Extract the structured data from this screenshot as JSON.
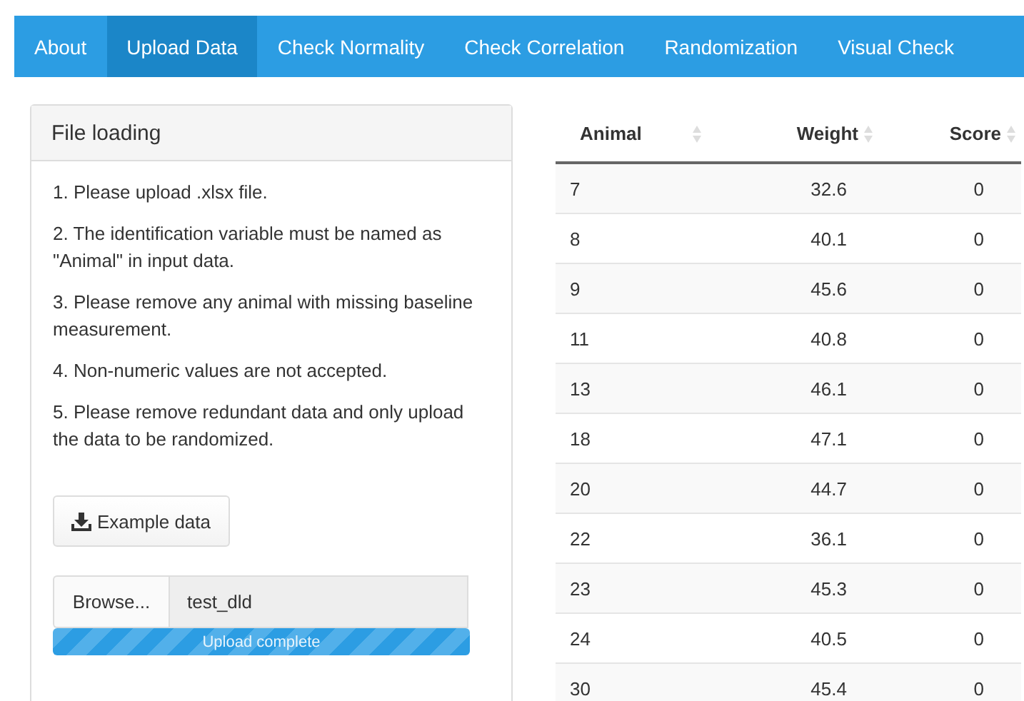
{
  "nav": {
    "tabs": [
      {
        "label": "About",
        "selected": false
      },
      {
        "label": "Upload Data",
        "selected": true
      },
      {
        "label": "Check Normality",
        "selected": false
      },
      {
        "label": "Check Correlation",
        "selected": false
      },
      {
        "label": "Randomization",
        "selected": false
      },
      {
        "label": "Visual Check",
        "selected": false
      }
    ]
  },
  "panel": {
    "title": "File loading",
    "instructions": [
      "1. Please upload .xlsx file.",
      "2. The identification variable must be named as \"Animal\" in input data.",
      "3. Please remove any animal with missing baseline measurement.",
      "4. Non-numeric values are not accepted.",
      "5. Please remove redundant data and only upload the data to be randomized."
    ],
    "example_button": "Example data",
    "browse_button": "Browse...",
    "file_name": "test_dld",
    "upload": {
      "label": "Upload complete",
      "level": 1
    }
  },
  "table": {
    "columns": [
      "Animal",
      "Weight",
      "Score"
    ],
    "rows": [
      [
        "7",
        "32.6",
        "0"
      ],
      [
        "8",
        "40.1",
        "0"
      ],
      [
        "9",
        "45.6",
        "0"
      ],
      [
        "11",
        "40.8",
        "0"
      ],
      [
        "13",
        "46.1",
        "0"
      ],
      [
        "18",
        "47.1",
        "0"
      ],
      [
        "20",
        "44.7",
        "0"
      ],
      [
        "22",
        "36.1",
        "0"
      ],
      [
        "23",
        "45.3",
        "0"
      ],
      [
        "24",
        "40.5",
        "0"
      ],
      [
        "30",
        "45.4",
        "0"
      ]
    ]
  }
}
